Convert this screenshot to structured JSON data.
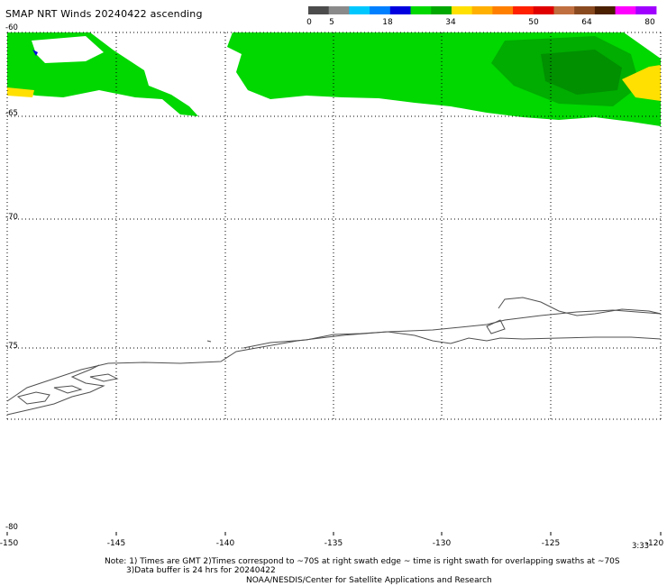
{
  "title": "SMAP NRT Winds 20240422 ascending",
  "colorbar": {
    "labels": [
      "0",
      "5",
      "18",
      "34",
      "50",
      "64",
      "80"
    ],
    "segments": [
      {
        "color": "#4c4c4c"
      },
      {
        "color": "#8a8a8a"
      },
      {
        "color": "#00c8ff"
      },
      {
        "color": "#0080ff"
      },
      {
        "color": "#0000e0"
      },
      {
        "color": "#00d800"
      },
      {
        "color": "#00a800"
      },
      {
        "color": "#ffe000"
      },
      {
        "color": "#ffb000"
      },
      {
        "color": "#ff8000"
      },
      {
        "color": "#ff2000"
      },
      {
        "color": "#e00000"
      },
      {
        "color": "#c07040"
      },
      {
        "color": "#8a4a20"
      },
      {
        "color": "#4a2000"
      },
      {
        "color": "#ff00ff"
      },
      {
        "color": "#a000ff"
      }
    ]
  },
  "latitudes": [
    "-60",
    "-65",
    "-70",
    "-75",
    "-80"
  ],
  "longitudes": [
    "-150",
    "-145",
    "-140",
    "-135",
    "-130",
    "-125",
    "-120"
  ],
  "time_label": "3:33",
  "notes": [
    "Note: 1) Times are GMT 2)Times correspond to ~70S at right swath edge ~ time is right swath for overlapping swaths at ~70S",
    "3)Data buffer is 24 hrs for 20240422",
    "NOAA/NESDIS/Center for Satellite Applications and Research"
  ],
  "colors": {
    "wind_green": "#00d800",
    "wind_dark_green": "#00a000",
    "wind_yellow": "#ffe000",
    "wind_blue": "#0000e0",
    "coast": "#505050",
    "grid": "#000000"
  }
}
